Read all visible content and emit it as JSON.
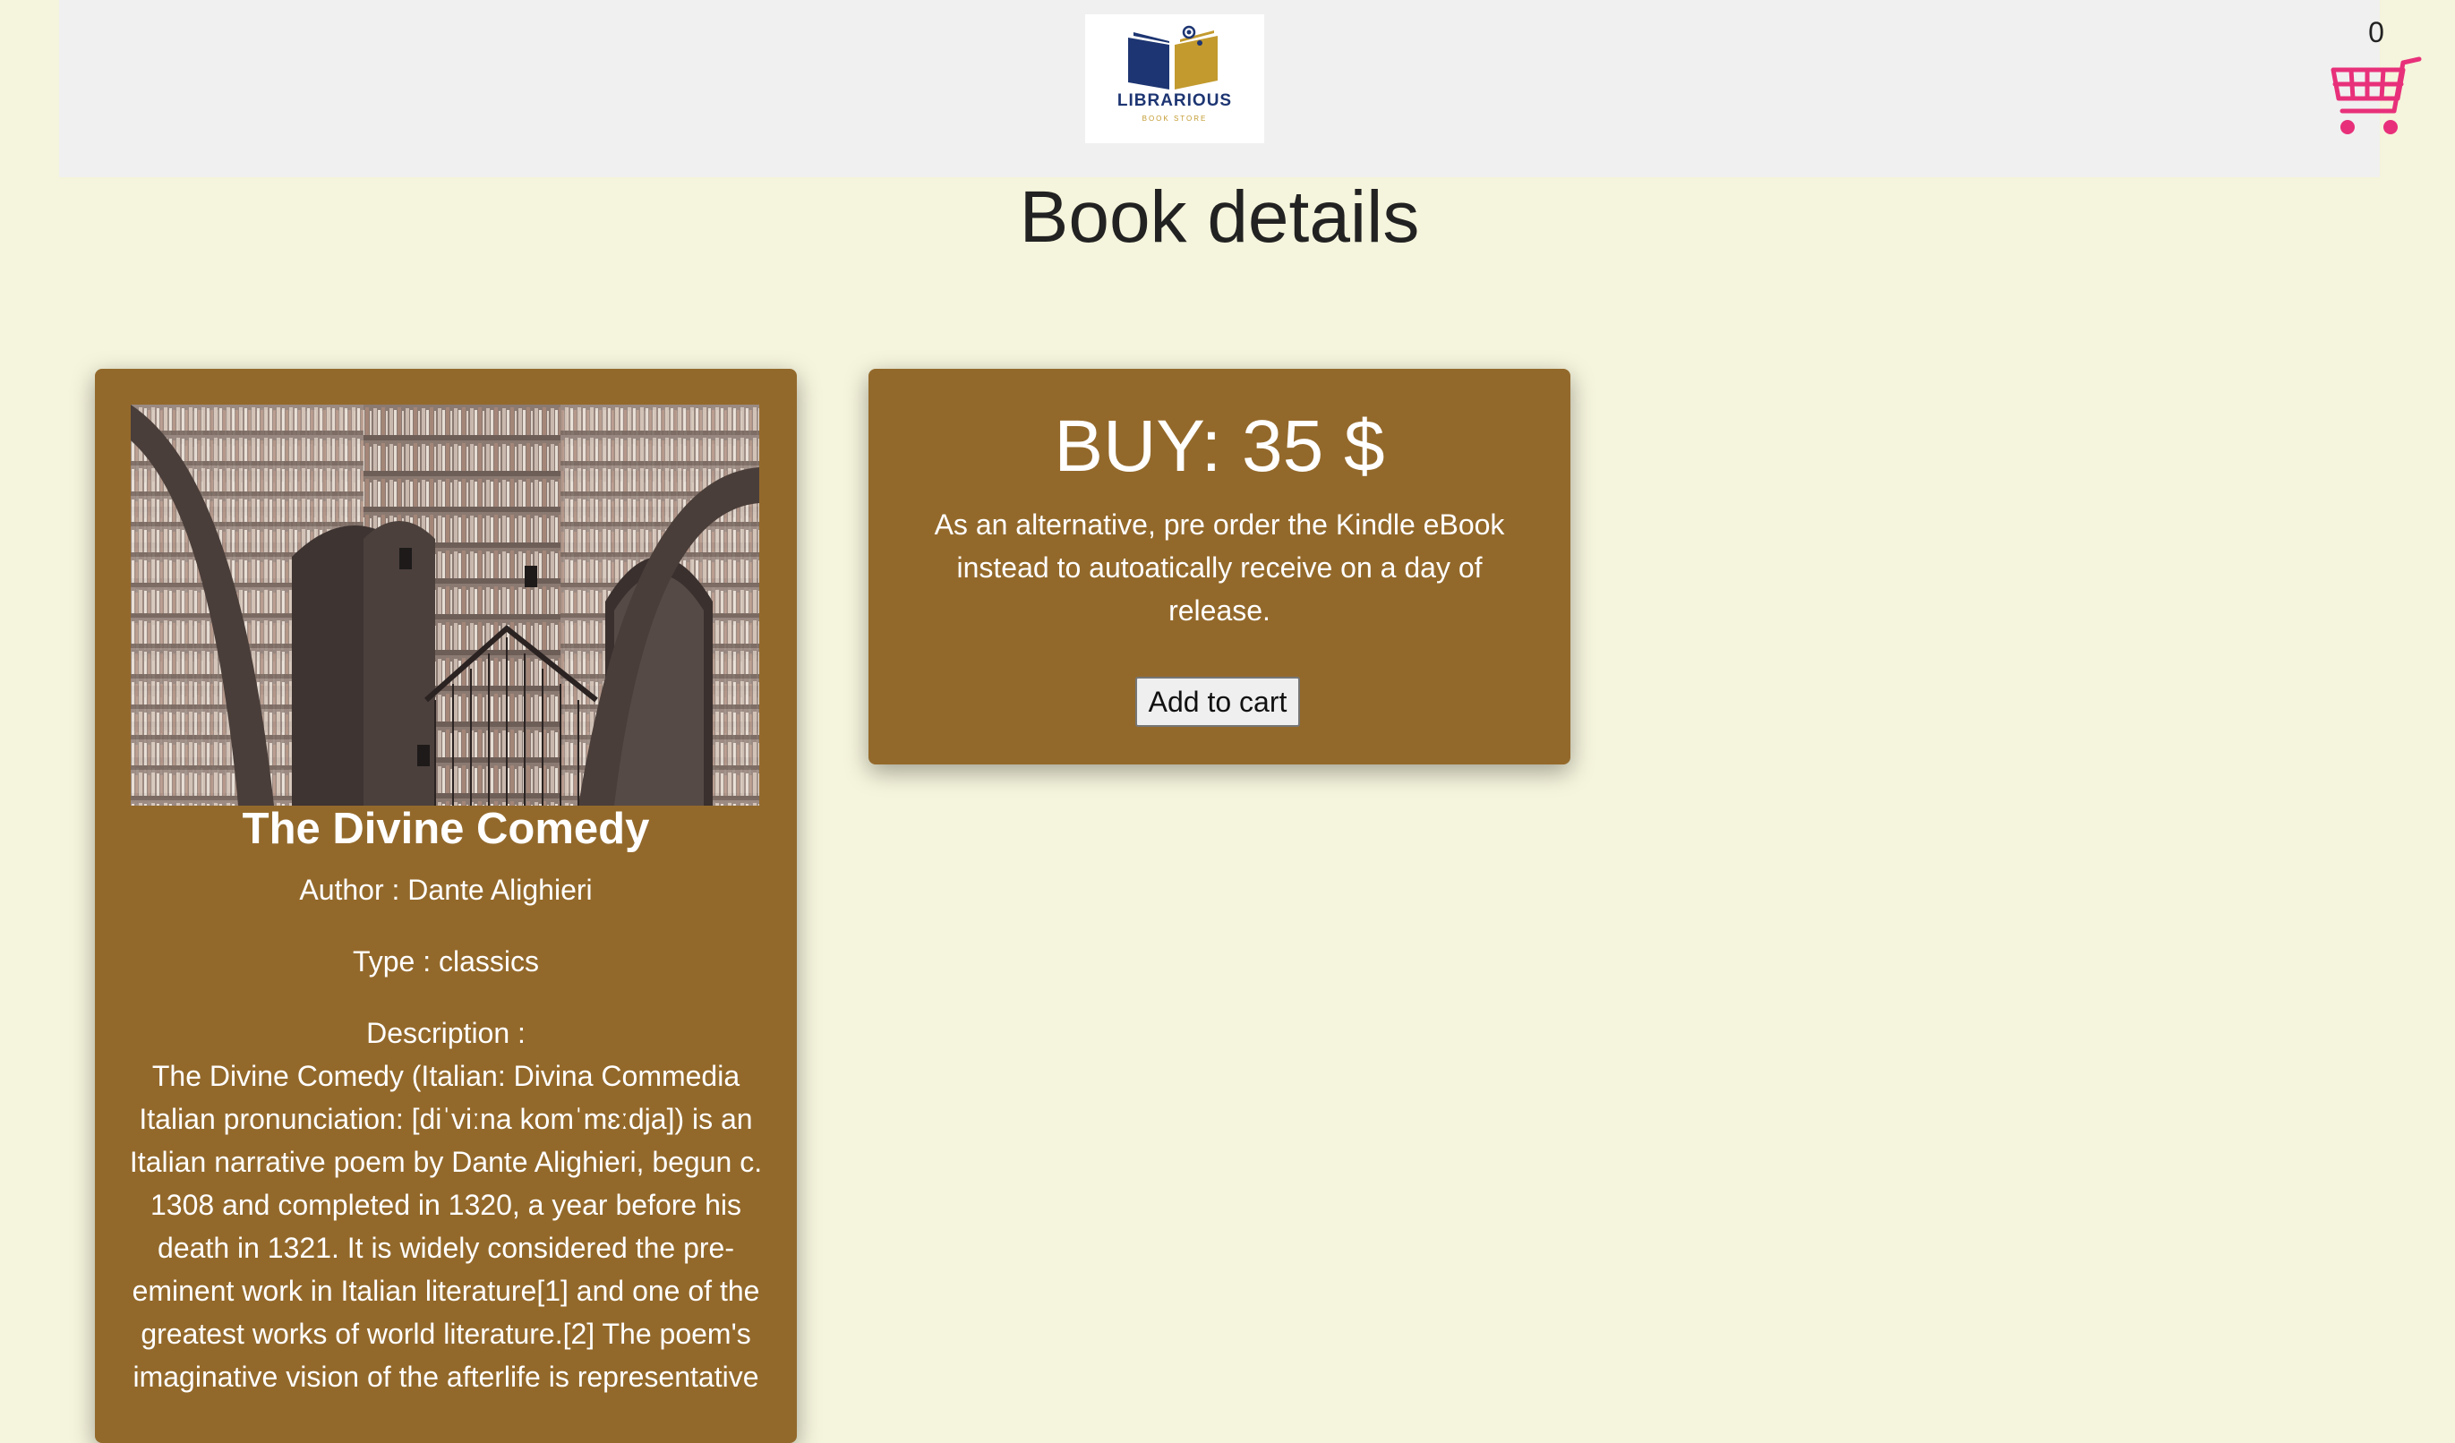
{
  "header": {
    "logo_title": "LIBRARIOUS",
    "logo_subtitle": "BOOK STORE",
    "cart_count": "0"
  },
  "page": {
    "title": "Book details"
  },
  "book": {
    "title": "The Divine Comedy",
    "author_line": "Author : Dante Alighieri",
    "type_line": "Type : classics",
    "description_label": "Description :",
    "description": "The Divine Comedy (Italian: Divina Commedia Italian pronunciation: [diˈviːna komˈmɛːdja]) is an Italian narrative poem by Dante Alighieri, begun c. 1308 and completed in 1320, a year before his death in 1321. It is widely considered the pre-eminent work in Italian literature[1] and one of the greatest works of world literature.[2] The poem's imaginative vision of the afterlife is representative"
  },
  "buy": {
    "price_line": "BUY: 35 $",
    "note": "As an alternative, pre order the Kindle eBook instead to autoatically receive on a day of release.",
    "add_to_cart_label": "Add to cart"
  },
  "colors": {
    "background": "#f5f4dc",
    "header": "#f0f0f0",
    "card": "#93692b",
    "cart_accent": "#e8307a",
    "logo_navy": "#1d3572",
    "logo_gold": "#c29a2e"
  }
}
